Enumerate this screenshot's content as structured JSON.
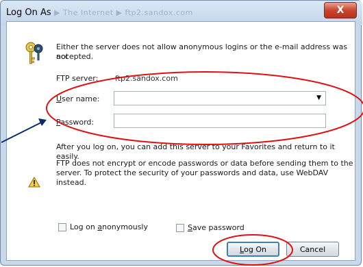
{
  "window": {
    "title": "Log On As",
    "ghost_path": "▶ The Internet ▶ ftp2.sandox.com",
    "close_glyph": "X"
  },
  "message": {
    "line1": "Either the server does not allow anonymous logins or the e-mail address was not",
    "line2": "accepted."
  },
  "ftp_server": {
    "label": "FTP server:",
    "value": "ftp2.sandox.com"
  },
  "username": {
    "label_u": "U",
    "label_rest": "ser name:",
    "value": ""
  },
  "password": {
    "label_u": "P",
    "label_rest": "assword:",
    "value": ""
  },
  "after_logon": "After you log on, you can add this server to your Favorites and return to it easily.",
  "warning": {
    "line1": "FTP does not encrypt or encode passwords or data before sending them to the",
    "line2": "server.  To protect the security of your passwords and data, use WebDAV instead."
  },
  "anonymous": {
    "label_pre": "Log on ",
    "label_u": "a",
    "label_rest": "nonymously",
    "checked": false
  },
  "save_password": {
    "label_u": "S",
    "label_rest": "ave password",
    "checked": false
  },
  "buttons": {
    "logon_u": "L",
    "logon_rest": "og On",
    "cancel": "Cancel"
  },
  "annotation_color": "#e01010"
}
